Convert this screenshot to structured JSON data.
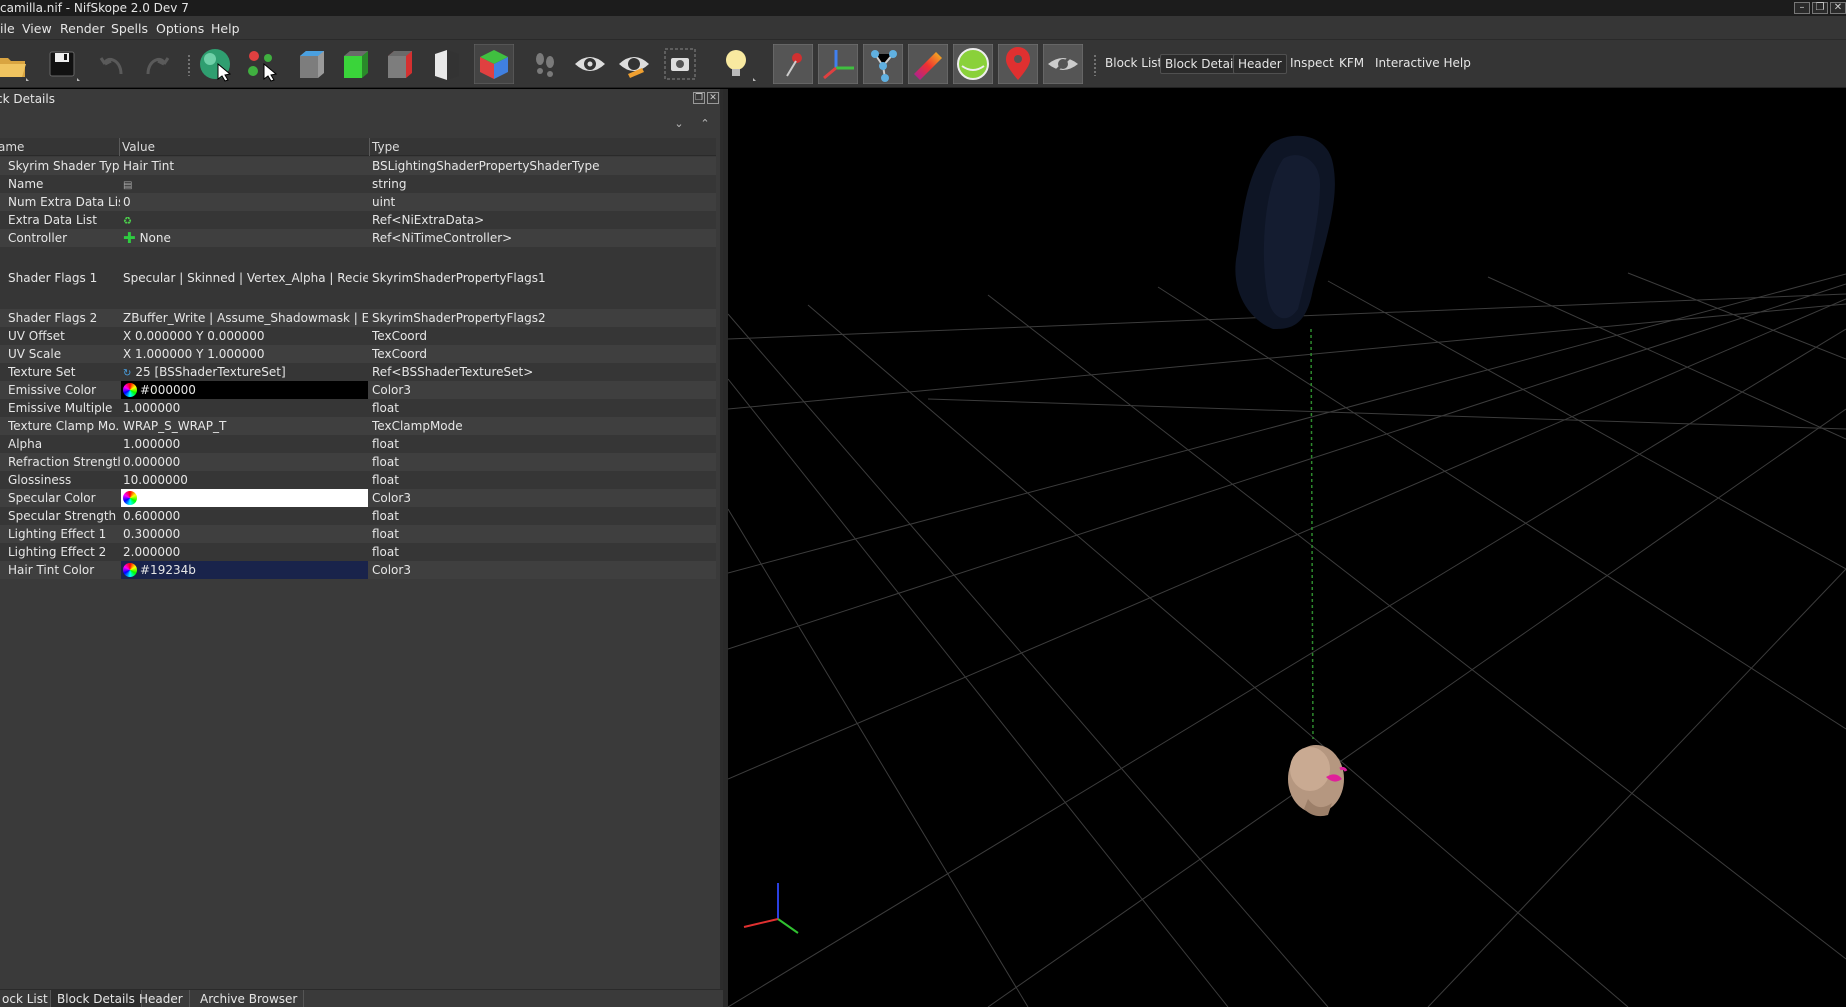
{
  "window": {
    "title": "camilla.nif - NifSkope 2.0 Dev 7"
  },
  "menu": [
    "ile",
    "View",
    "Render",
    "Spells",
    "Options",
    "Help"
  ],
  "toolbar": {
    "icons": [
      "open-icon",
      "save-icon",
      "undo-icon",
      "redo-icon",
      "select-object-icon",
      "select-vertex-icon",
      "cube-grey-icon",
      "cube-green-icon",
      "cube-red-icon",
      "half-cube-icon",
      "color-cube-icon",
      "footprints-icon",
      "eye-icon",
      "eye-orange-icon",
      "screenshot-icon",
      "light-bulb-icon",
      "pin-icon",
      "axes-icon",
      "nodes-icon",
      "gradient-icon",
      "green-circle-icon",
      "map-marker-icon",
      "hide-eye-icon"
    ],
    "text_buttons": [
      {
        "label": "Block List",
        "checked": false
      },
      {
        "label": "Block Details",
        "checked": true
      },
      {
        "label": "Header",
        "checked": true
      },
      {
        "label": "Inspect",
        "checked": false
      },
      {
        "label": "KFM",
        "checked": false
      },
      {
        "label": "Interactive Help",
        "checked": false
      }
    ]
  },
  "dock": {
    "title": "ck Details",
    "columns": {
      "name": "ame",
      "value": "Value",
      "type": "Type"
    },
    "rows": [
      {
        "name": "Skyrim Shader Type",
        "value": "Hair Tint",
        "type": "BSLightingShaderPropertyShaderType"
      },
      {
        "name": "Name",
        "value": "",
        "type": "string",
        "icon": "txt"
      },
      {
        "name": "Num Extra Data List",
        "value": "0",
        "type": "uint"
      },
      {
        "name": "Extra Data List",
        "value": "",
        "type": "Ref<NiExtraData>",
        "icon": "refresh"
      },
      {
        "name": "Controller",
        "value": "None",
        "type": "Ref<NiTimeController>",
        "icon": "plus"
      },
      {
        "name": "Shader Flags 1",
        "value": "Specular | Skinned | Vertex_Alpha | Recieve_S...",
        "type": "SkyrimShaderPropertyFlags1",
        "tall": true
      },
      {
        "name": "Shader Flags 2",
        "value": "ZBuffer_Write | Assume_Shadowmask | Env...",
        "type": "SkyrimShaderPropertyFlags2"
      },
      {
        "name": "UV Offset",
        "value": "X 0.000000 Y 0.000000",
        "type": "TexCoord"
      },
      {
        "name": "UV Scale",
        "value": "X 1.000000 Y 1.000000",
        "type": "TexCoord"
      },
      {
        "name": "Texture Set",
        "value": "25 [BSShaderTextureSet]",
        "type": "Ref<BSShaderTextureSet>",
        "icon": "link"
      },
      {
        "name": "Emissive Color",
        "value": "#000000",
        "type": "Color3",
        "icon": "wheel",
        "bg": "#000000"
      },
      {
        "name": "Emissive Multiple",
        "value": "1.000000",
        "type": "float"
      },
      {
        "name": "Texture Clamp Mo...",
        "value": "WRAP_S_WRAP_T",
        "type": "TexClampMode"
      },
      {
        "name": "Alpha",
        "value": "1.000000",
        "type": "float"
      },
      {
        "name": "Refraction Strength",
        "value": "0.000000",
        "type": "float"
      },
      {
        "name": "Glossiness",
        "value": "10.000000",
        "type": "float"
      },
      {
        "name": "Specular Color",
        "value": "",
        "type": "Color3",
        "icon": "wheel",
        "bg": "#ffffff"
      },
      {
        "name": "Specular Strength",
        "value": "0.600000",
        "type": "float"
      },
      {
        "name": "Lighting Effect 1",
        "value": "0.300000",
        "type": "float"
      },
      {
        "name": "Lighting Effect 2",
        "value": "2.000000",
        "type": "float"
      },
      {
        "name": "Hair Tint Color",
        "value": "#19234b",
        "type": "Color3",
        "icon": "wheel",
        "bg": "#19234b"
      }
    ]
  },
  "bottom_tabs": [
    {
      "label": "ock List",
      "active": false
    },
    {
      "label": "Block Details",
      "active": true
    },
    {
      "label": "Header",
      "active": false
    },
    {
      "label": "Archive Browser",
      "active": false
    }
  ],
  "colors": {
    "hair_tint": "#19234b",
    "grid": "#3c3c3c",
    "viewport_bg": "#000000"
  }
}
